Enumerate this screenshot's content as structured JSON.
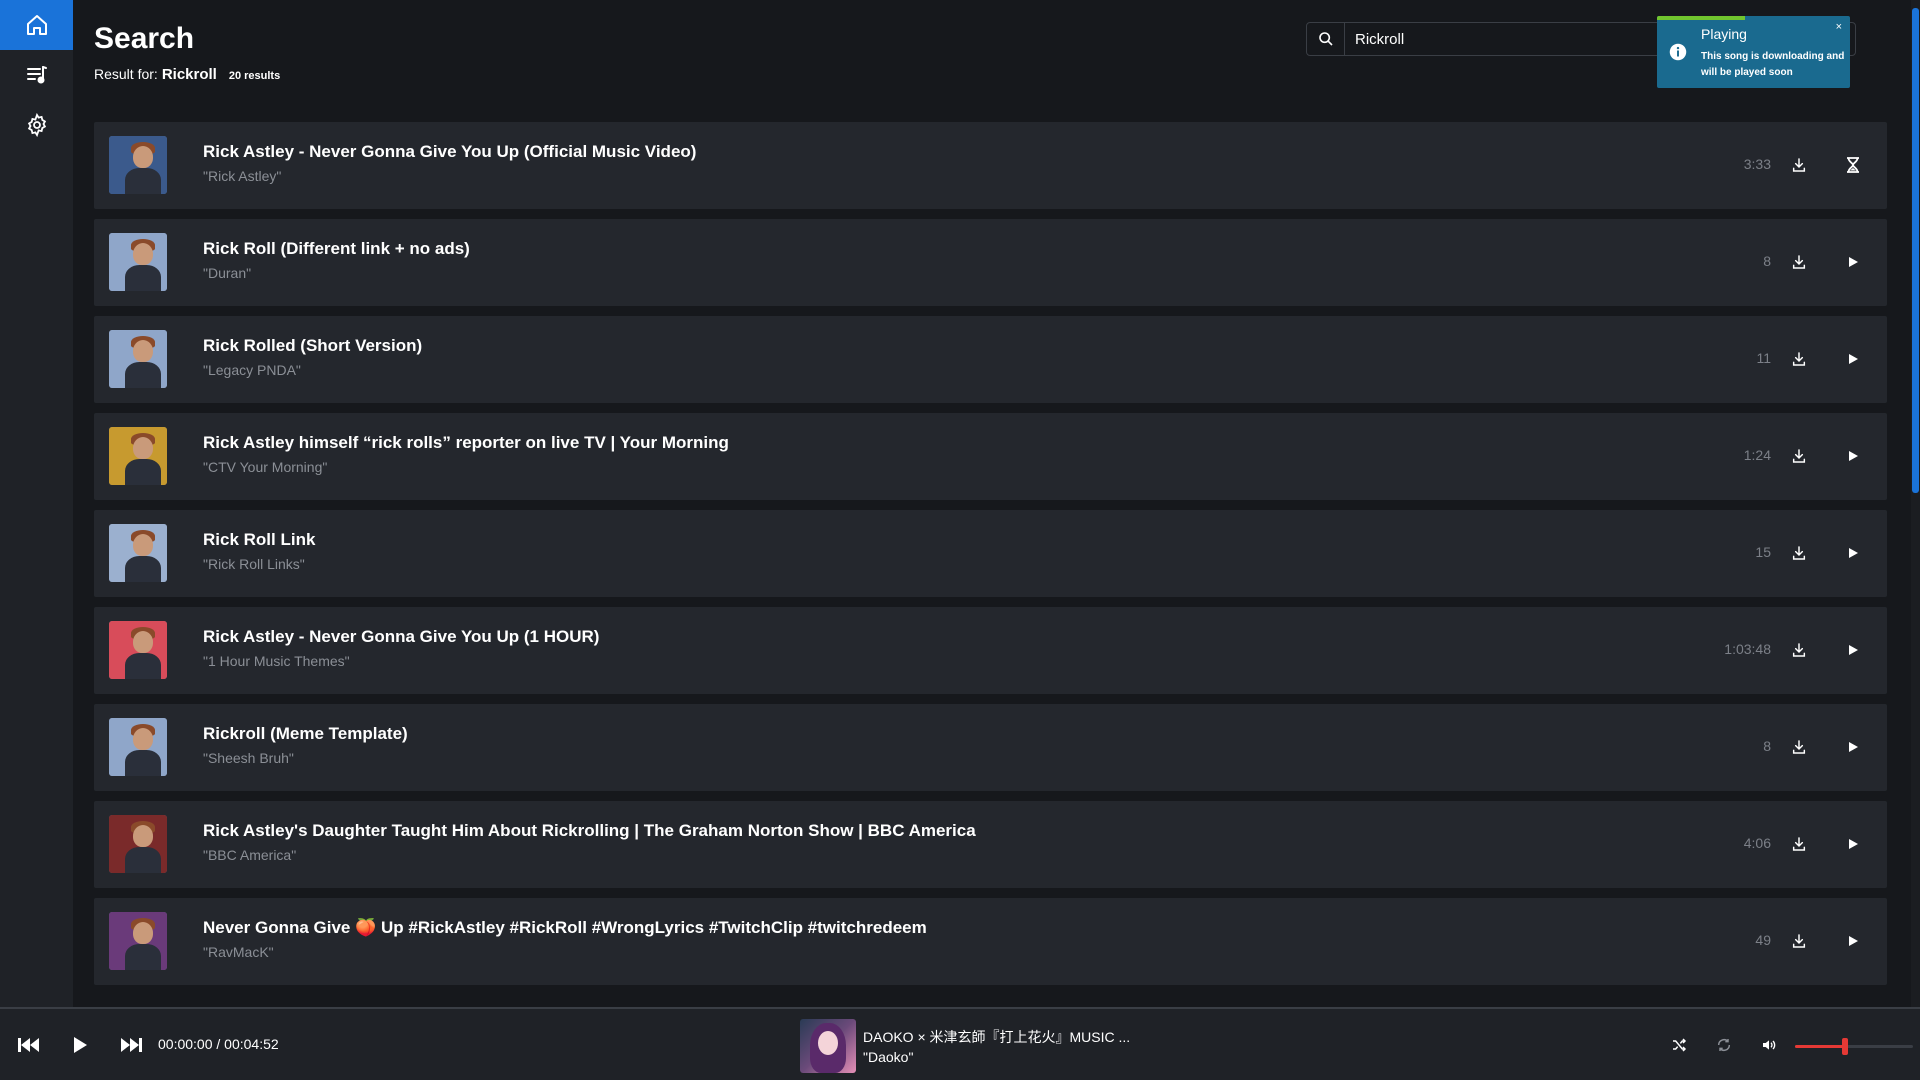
{
  "page": {
    "title": "Search",
    "result_prefix": "Result for:",
    "query": "Rickroll",
    "result_count": "20 results"
  },
  "sidebar": {
    "items": [
      {
        "name": "home",
        "active": true
      },
      {
        "name": "playlist",
        "active": false
      },
      {
        "name": "settings",
        "active": false
      }
    ]
  },
  "search": {
    "value": "Rickroll",
    "placeholder": ""
  },
  "toast": {
    "title": "Playing",
    "message": "This song is downloading and will be played soon",
    "close": "×"
  },
  "results": [
    {
      "title": "Rick Astley - Never Gonna Give You Up (Official Music Video)",
      "artist": "\"Rick Astley\"",
      "duration": "3:33",
      "status": "downloading",
      "thumb": "#3b5a8c"
    },
    {
      "title": "Rick Roll (Different link + no ads)",
      "artist": "\"Duran\"",
      "duration": "8",
      "status": "play",
      "thumb": "#8fa6c9"
    },
    {
      "title": "Rick Rolled (Short Version)",
      "artist": "\"Legacy PNDA\"",
      "duration": "11",
      "status": "play",
      "thumb": "#8fa6c9"
    },
    {
      "title": "Rick Astley himself “rick rolls” reporter on live TV | Your Morning",
      "artist": "\"CTV Your Morning\"",
      "duration": "1:24",
      "status": "play",
      "thumb": "#c79a2f"
    },
    {
      "title": "Rick Roll Link",
      "artist": "\"Rick Roll Links\"",
      "duration": "15",
      "status": "play",
      "thumb": "#9bb0cf"
    },
    {
      "title": "Rick Astley - Never Gonna Give You Up (1 HOUR)",
      "artist": "\"1 Hour Music Themes\"",
      "duration": "1:03:48",
      "status": "play",
      "thumb": "#d84c5a"
    },
    {
      "title": "Rickroll (Meme Template)",
      "artist": "\"Sheesh Bruh\"",
      "duration": "8",
      "status": "play",
      "thumb": "#8fa6c9"
    },
    {
      "title": "Rick Astley's Daughter Taught Him About Rickrolling | The Graham Norton Show | BBC America",
      "artist": "\"BBC America\"",
      "duration": "4:06",
      "status": "play",
      "thumb": "#7a2a2a"
    },
    {
      "title": "Never Gonna Give 🍑 Up #RickAstley #RickRoll #WrongLyrics #TwitchClip #twitchredeem",
      "artist": "\"RavMacK\"",
      "duration": "49",
      "status": "play",
      "thumb": "#6a3a7a"
    }
  ],
  "player": {
    "time": "00:00:00 / 00:04:52",
    "now_playing_title": "DAOKO × 米津玄師『打上花火』MUSIC ...",
    "now_playing_artist": "\"Daoko\"",
    "volume": 0.42
  },
  "colors": {
    "accent": "#1a73d9",
    "toast": "#1a6a8f",
    "toast_progress": "#71c52f",
    "volume": "#e53935"
  },
  "icons": [
    "home-icon",
    "playlist-icon",
    "settings-icon",
    "search-icon",
    "download-icon",
    "play-icon",
    "hourglass-icon",
    "info-icon",
    "previous-icon",
    "next-icon",
    "shuffle-icon",
    "repeat-icon",
    "volume-icon"
  ]
}
